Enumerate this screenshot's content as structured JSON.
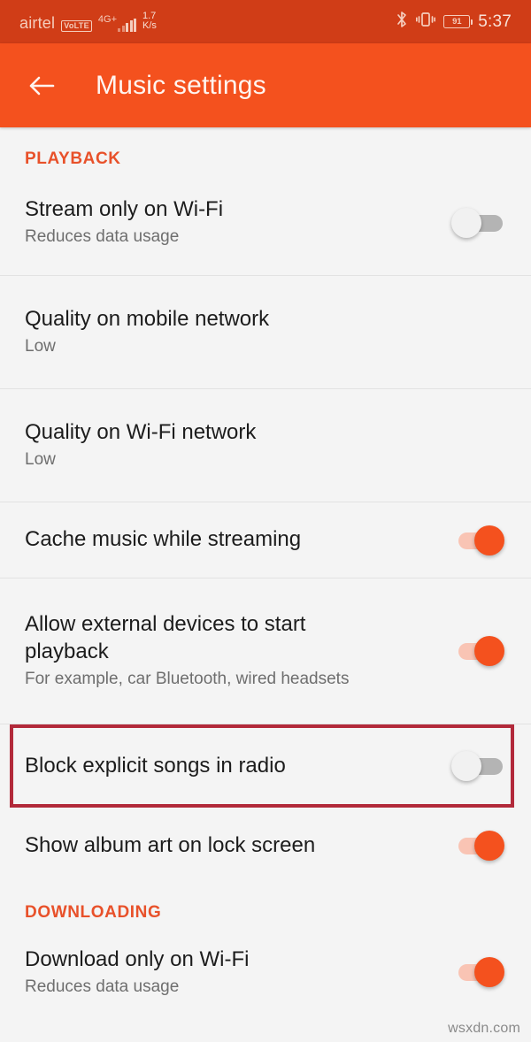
{
  "statusbar": {
    "carrier": "airtel",
    "volte_badge": "VoLTE",
    "network_type": "4G+",
    "data_speed_value": "1.7",
    "data_speed_unit": "K/s",
    "battery_percent": "91",
    "time": "5:37",
    "icons": [
      "bluetooth-icon",
      "vibrate-icon",
      "battery-icon"
    ]
  },
  "appbar": {
    "back_icon": "back-arrow-icon",
    "title": "Music settings"
  },
  "sections": [
    {
      "header": "PLAYBACK",
      "rows": [
        {
          "title": "Stream only on Wi-Fi",
          "subtitle": "Reduces data usage",
          "control": "toggle",
          "state": "off"
        },
        {
          "title": "Quality on mobile network",
          "subtitle": "Low",
          "control": "none",
          "state": ""
        },
        {
          "title": "Quality on Wi-Fi network",
          "subtitle": "Low",
          "control": "none",
          "state": ""
        },
        {
          "title": "Cache music while streaming",
          "subtitle": "",
          "control": "toggle",
          "state": "on"
        },
        {
          "title": "Allow external devices to start playback",
          "subtitle": "For example, car Bluetooth, wired headsets",
          "control": "toggle",
          "state": "on"
        },
        {
          "title": "Block explicit songs in radio",
          "subtitle": "",
          "control": "toggle",
          "state": "off",
          "highlighted": true
        },
        {
          "title": "Show album art on lock screen",
          "subtitle": "",
          "control": "toggle",
          "state": "on"
        }
      ]
    },
    {
      "header": "DOWNLOADING",
      "rows": [
        {
          "title": "Download only on Wi-Fi",
          "subtitle": "Reduces data usage",
          "control": "toggle",
          "state": "on"
        }
      ]
    }
  ],
  "watermark": "wsxdn.com",
  "colors": {
    "statusbar_bg": "#D03D17",
    "appbar_bg": "#F4511E",
    "accent": "#E8512A",
    "toggle_on": "#F4511E",
    "toggle_on_track": "#F9C4B4",
    "toggle_off_track": "#B4B4B4",
    "page_bg": "#F4F4F4",
    "highlight_border": "#B2293A"
  }
}
